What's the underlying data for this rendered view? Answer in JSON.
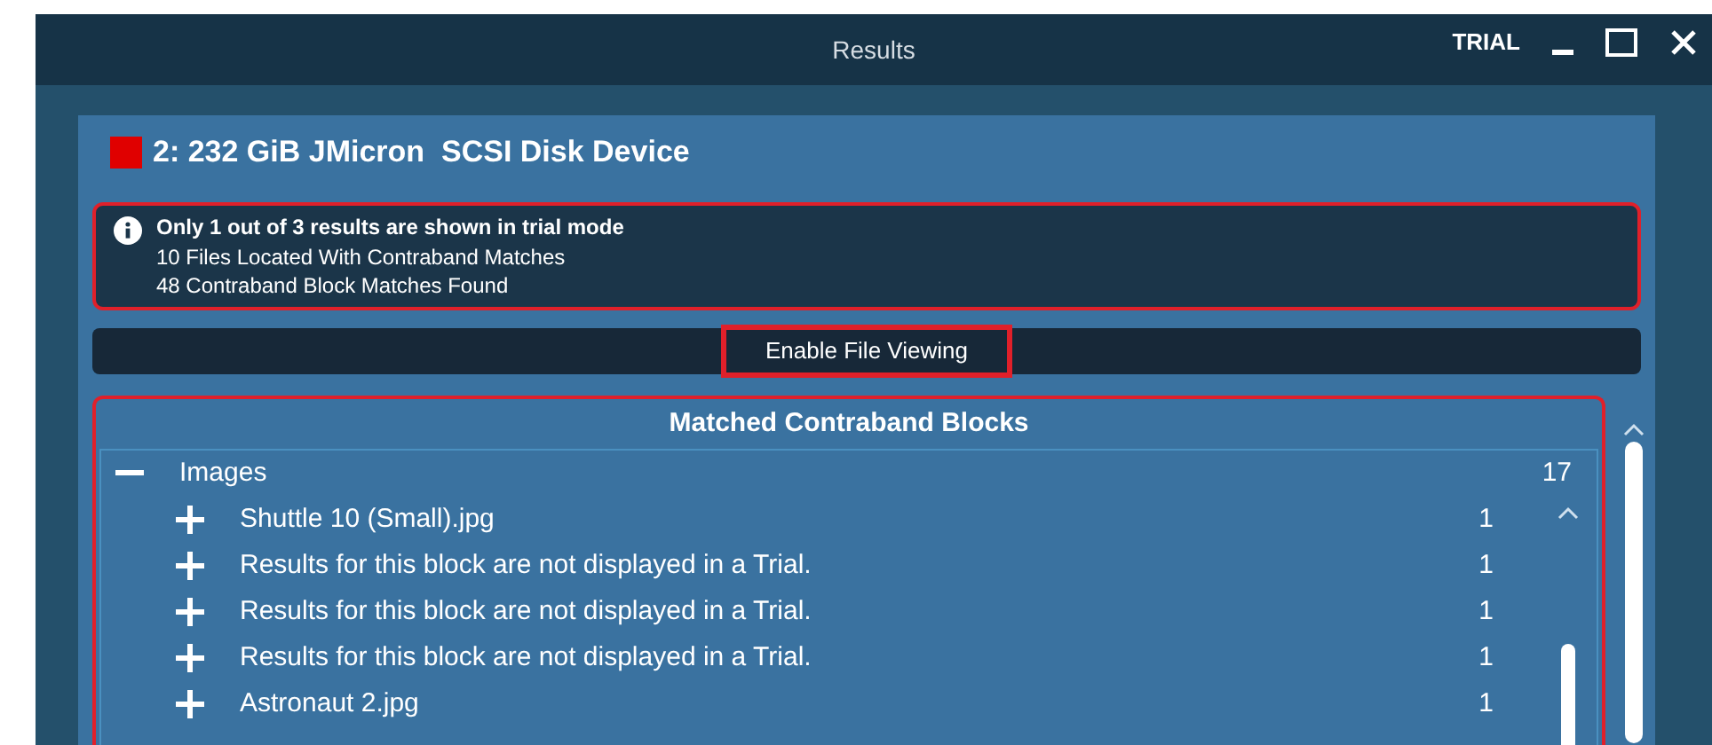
{
  "window": {
    "title": "Results",
    "badge": "TRIAL"
  },
  "device": {
    "name": "2: 232 GiB JMicron  SCSI Disk Device",
    "color": "#e00000"
  },
  "notice": {
    "title": "Only 1 out of 3 results are shown in trial mode",
    "lines": [
      "10 Files Located With Contraband Matches",
      "48 Contraband Block Matches Found"
    ]
  },
  "enable_button": "Enable File Viewing",
  "matched": {
    "title": "Matched Contraband Blocks",
    "tree": [
      {
        "label": "Images",
        "count": "17",
        "expanded": true,
        "children": [
          {
            "label": "Shuttle 10 (Small).jpg",
            "count": "1",
            "expanded": false
          },
          {
            "label": "Results for this block are not displayed in a Trial.",
            "count": "1",
            "expanded": false
          },
          {
            "label": "Results for this block are not displayed in a Trial.",
            "count": "1",
            "expanded": false
          },
          {
            "label": "Results for this block are not displayed in a Trial.",
            "count": "1",
            "expanded": false
          },
          {
            "label": "Astronaut 2.jpg",
            "count": "1",
            "expanded": false
          }
        ]
      }
    ]
  }
}
